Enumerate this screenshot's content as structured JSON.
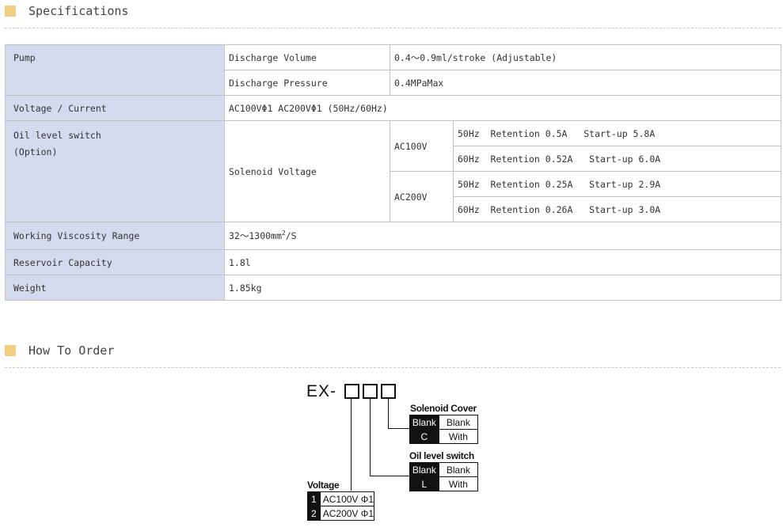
{
  "sections": {
    "specifications": "Specifications",
    "how_to_order": "How To Order"
  },
  "spec": {
    "pump_label": "Pump",
    "discharge_volume_label": "Discharge Volume",
    "discharge_volume_value": "0.4〜0.9ml/stroke (Adjustable)",
    "discharge_pressure_label": "Discharge Pressure",
    "discharge_pressure_value": "0.4MPaMax",
    "voltage_label": "Voltage / Current",
    "voltage_value": "AC100VΦ1  AC200VΦ1 (50Hz/60Hz)",
    "oil_switch_label_1": "Oil level switch",
    "oil_switch_label_2": "(Option)",
    "solenoid_voltage_label": "Solenoid Voltage",
    "ac100v": "AC100V",
    "ac200v": "AC200V",
    "ac100v_50hz": "50Hz  Retention 0.5A   Start-up 5.8A",
    "ac100v_60hz": "60Hz  Retention 0.52A   Start-up 6.0A",
    "ac200v_50hz": "50Hz  Retention 0.25A   Start-up 2.9A",
    "ac200v_60hz": "60Hz  Retention 0.26A   Start-up 3.0A",
    "viscosity_label": "Working Viscosity Range",
    "viscosity_value_base": "32〜1300mm",
    "viscosity_value_sup": "2",
    "viscosity_value_unit": "/S",
    "reservoir_label": "Reservoir Capacity",
    "reservoir_value": "1.8l",
    "weight_label": "Weight",
    "weight_value": "1.85kg"
  },
  "order": {
    "model_prefix": "EX-",
    "solenoid_cover": {
      "title": "Solenoid Cover",
      "rows": [
        {
          "code": "Blank",
          "value": "Blank"
        },
        {
          "code": "C",
          "value": "With"
        }
      ]
    },
    "oil_level_switch": {
      "title": "Oil level switch",
      "rows": [
        {
          "code": "Blank",
          "value": "Blank"
        },
        {
          "code": "L",
          "value": "With"
        }
      ]
    },
    "voltage": {
      "title": "Voltage",
      "rows": [
        {
          "code": "1",
          "value": "AC100V Φ1"
        },
        {
          "code": "2",
          "value": "AC200V Φ1"
        }
      ]
    }
  },
  "colors": {
    "header_cell_bg": "#d4dbef",
    "section_square": "#f0cf82"
  }
}
